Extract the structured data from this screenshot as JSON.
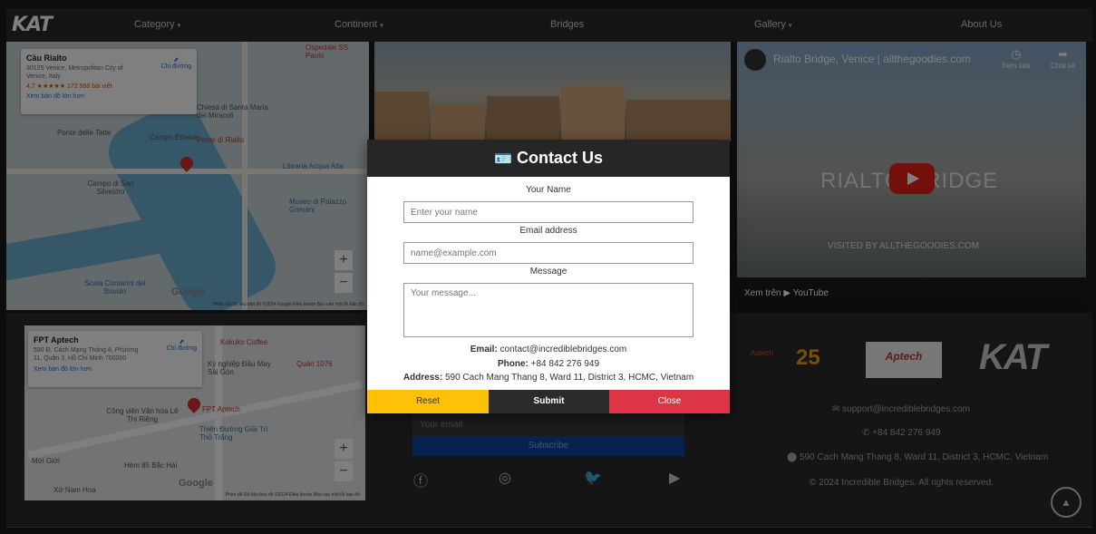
{
  "nav": {
    "logo": "KAT",
    "items": [
      {
        "label": "Category",
        "caret": "▾"
      },
      {
        "label": "Continent",
        "caret": "▾"
      },
      {
        "label": "Bridges",
        "caret": ""
      },
      {
        "label": "Gallery",
        "caret": "▾"
      },
      {
        "label": "About Us",
        "caret": ""
      }
    ]
  },
  "map1": {
    "place": "Cầu Rialto",
    "address": "30125 Venice, Metropolitan City of Venice, Italy",
    "rating": "4,7 ★★★★★  172.988 bài viết",
    "larger_map": "Xem bản đồ lớn hơn",
    "directions": "Chỉ đường",
    "labels": [
      "Ponte delle Tette",
      "Campo Erberia",
      "Chiesa di Santa Maria dei Miracoli",
      "Ponte di Rialto",
      "Libreria Acqua Alta",
      "Campo di San Silvestro",
      "Museo di Palazzo Grimani",
      "Scala Contarini del Bovolo",
      "Ospedale SS. Paolo"
    ],
    "footer": "Phím tắt  Dữ liệu bản đồ ©2024 Google  Điều khoản  Báo cáo một lỗi bản đồ",
    "google": "Google"
  },
  "map2": {
    "place": "FPT Aptech",
    "address": "590 Đ. Cách Mạng Tháng 8, Phường 11, Quận 3, Hồ Chí Minh 700000",
    "larger_map": "Xem bản đồ lớn hơn",
    "directions": "Chỉ đường",
    "labels": [
      "Kokuko Coffee",
      "Kỳ nghiệp Đầu May Sài Gòn",
      "Quán 1076",
      "Công viên Văn hóa Lê Thị Riêng",
      "FPT Aptech",
      "Thiên Đường Giải Trí Thỏ Trắng",
      "Mới Giới",
      "Xứ Nam Hoa",
      "Hẻm 85 Bắc Hải"
    ],
    "footer": "Phím tắt  Dữ liệu bản đồ ©2024  Điều khoản  Báo cáo một lỗi bản đồ",
    "google": "Google"
  },
  "video": {
    "title": "Rialto Bridge, Venice | allthegoodies.com",
    "watch_later": "Xem sau",
    "share": "Chia sẻ",
    "overlay_big": "RIALTO BRIDGE",
    "overlay_small": "VISITED BY ALLTHEGOODIES.COM",
    "watch_on": "Xem trên  ▶ YouTube"
  },
  "modal": {
    "icon": "contact-card",
    "title": "Contact Us",
    "name_label": "Your Name",
    "name_placeholder": "Enter your name",
    "email_label": "Email address",
    "email_placeholder": "name@example.com",
    "message_label": "Message",
    "message_placeholder": "Your message...",
    "email_key": "Email:",
    "email_value": " contact@incrediblebridges.com",
    "phone_key": "Phone:",
    "phone_value": " +84 842 276 949",
    "address_key": "Address:",
    "address_value": " 590 Cach Mang Thang 8, Ward 11, District 3, HCMC, Vietnam",
    "reset": "Reset",
    "submit": "Submit",
    "close": "Close",
    "colors": {
      "reset": "#ffc107",
      "submit": "#343a40",
      "close": "#dc3545"
    }
  },
  "footer": {
    "subscribe_placeholder": "Your email",
    "subscribe_button": "Subscribe",
    "social": [
      "facebook-icon",
      "instagram-icon",
      "twitter-icon",
      "youtube-icon"
    ],
    "email": "support@incrediblebridges.com",
    "phone": "+84 842 276 949",
    "address": "590 Cach Mang Thang 8, Ward 11, District 3, HCMC, Vietnam",
    "copyright": "© 2024 Incredible Bridges. All rights reserved.",
    "brand_aptech": "Aptech",
    "brand_25": "25",
    "brand_logo": "KAT"
  }
}
